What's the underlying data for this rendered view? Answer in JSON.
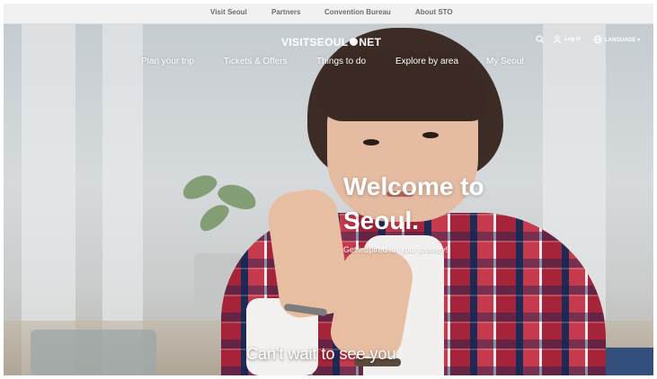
{
  "topbar": {
    "links": [
      "Visit Seoul",
      "Partners",
      "Convention Bureau",
      "About STO"
    ]
  },
  "header": {
    "logo_left": "VISITSEOUL",
    "logo_right": "NET",
    "utility": {
      "search_icon": "search-icon",
      "login_label": "Log in",
      "language_label": "LANGUAGE"
    },
    "nav": [
      "Plan your trip",
      "Tickets & Offers",
      "Things to do",
      "Explore by area",
      "My Seoul"
    ]
  },
  "hero": {
    "headline_line1": "Welcome to",
    "headline_line2": "Seoul.",
    "subtitle": "Get inspired for your journey!",
    "caption": "Can't wait to see you"
  },
  "colors": {
    "topbar_bg": "#f1f1f1",
    "topbar_text": "#6d6d6d",
    "hero_text": "#ffffff"
  }
}
